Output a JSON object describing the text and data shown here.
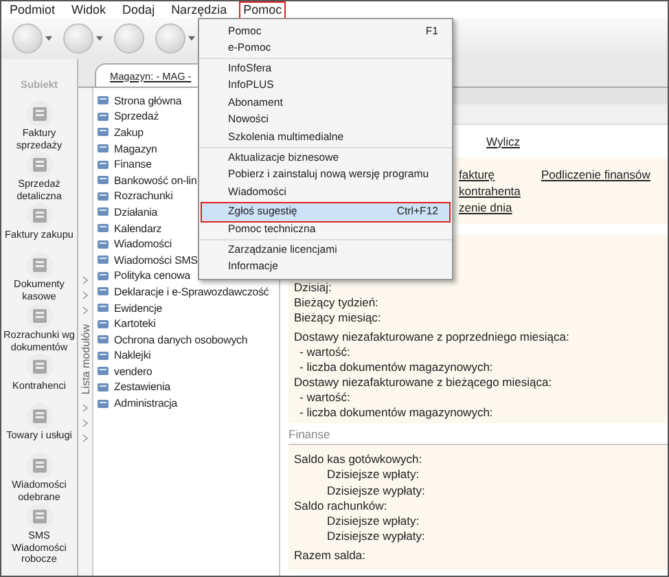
{
  "menubar": [
    {
      "label": "Podmiot",
      "selected": false
    },
    {
      "label": "Widok",
      "selected": false
    },
    {
      "label": "Dodaj",
      "selected": false
    },
    {
      "label": "Narzędzia",
      "selected": false
    },
    {
      "label": "Pomoc",
      "selected": true
    }
  ],
  "toolbar": [
    {
      "dropdown": true
    },
    {
      "dropdown": true
    },
    {
      "dropdown": false
    },
    {
      "dropdown": true
    }
  ],
  "logo": "Subiekt",
  "shortcuts": [
    "Faktury sprzedaży",
    "Sprzedaż detaliczna",
    "Faktury zakupu",
    "Dokumenty kasowe",
    "Rozrachunki wg dokumentów",
    "Kontrahenci",
    "Towary i usługi",
    "Wiadomości odebrane",
    "SMS Wiadomości robocze"
  ],
  "tab": "Magazyn: - MAG -",
  "modules_strip": "Lista modułów",
  "modules": [
    "Strona główna",
    "Sprzedaż",
    "Zakup",
    "Magazyn",
    "Finanse",
    "Bankowość on-lin",
    "Rozrachunki",
    "Działania",
    "Kalendarz",
    "Wiadomości",
    "Wiadomości SMS",
    "Polityka cenowa",
    "Deklaracje i e-Sprawozdawczość",
    "Ewidencje",
    "Kartoteki",
    "Ochrona danych osobowych",
    "Naklejki",
    "vendero",
    "Zestawienia",
    "Administracja"
  ],
  "links_top": "Wylicz",
  "links": [
    [
      "fakturę",
      "Podliczenie finansów"
    ],
    [
      "kontrahenta"
    ],
    [
      "zenie dnia"
    ]
  ],
  "summary": [
    [
      {
        "label": "Dzisiaj:"
      },
      {
        "label": "Bieżący tydzień:"
      },
      {
        "label": "Bieżący miesiąc:"
      }
    ],
    [
      {
        "label": "Dostawy niezafakturowane z poprzedniego miesiąca:",
        "children": [
          {
            "label": "- wartość:"
          },
          {
            "label": "- liczba dokumentów magazynowych:"
          }
        ]
      },
      {
        "label": "Dostawy niezafakturowane z bieżącego miesiąca:",
        "children": [
          {
            "label": "- wartość:"
          },
          {
            "label": "- liczba dokumentów magazynowych:"
          }
        ]
      }
    ]
  ],
  "finance_title": "Finanse",
  "finance": [
    [
      {
        "label": "Saldo kas gotówkowych:",
        "children": [
          {
            "label": "Dzisiejsze wpłaty:"
          },
          {
            "label": "Dzisiejsze wypłaty:"
          }
        ]
      },
      {
        "label": "Saldo rachunków:",
        "children": [
          {
            "label": "Dzisiejsze wpłaty:"
          },
          {
            "label": "Dzisiejsze wypłaty:"
          }
        ]
      }
    ],
    [
      {
        "label": "Razem salda:"
      }
    ]
  ],
  "menu": [
    [
      {
        "label": "Pomoc",
        "shortcut": "F1",
        "selected": false
      },
      {
        "label": "e-Pomoc",
        "selected": false
      }
    ],
    [
      {
        "label": "InfoSfera",
        "selected": false
      },
      {
        "label": "InfoPLUS",
        "selected": false
      },
      {
        "label": "Abonament",
        "selected": false
      },
      {
        "label": "Nowości",
        "selected": false
      },
      {
        "label": "Szkolenia multimedialne",
        "selected": false
      }
    ],
    [
      {
        "label": "Aktualizacje biznesowe",
        "selected": false
      },
      {
        "label": "Pobierz i zainstaluj nową wersję programu",
        "selected": false
      },
      {
        "label": "Wiadomości",
        "selected": false
      }
    ],
    [
      {
        "label": "Zgłoś sugestię",
        "shortcut": "Ctrl+F12",
        "selected": true
      },
      {
        "label": "Pomoc techniczna",
        "selected": false
      }
    ],
    [
      {
        "label": "Zarządzanie licencjami",
        "selected": false
      },
      {
        "label": "Informacje",
        "selected": false
      }
    ]
  ]
}
